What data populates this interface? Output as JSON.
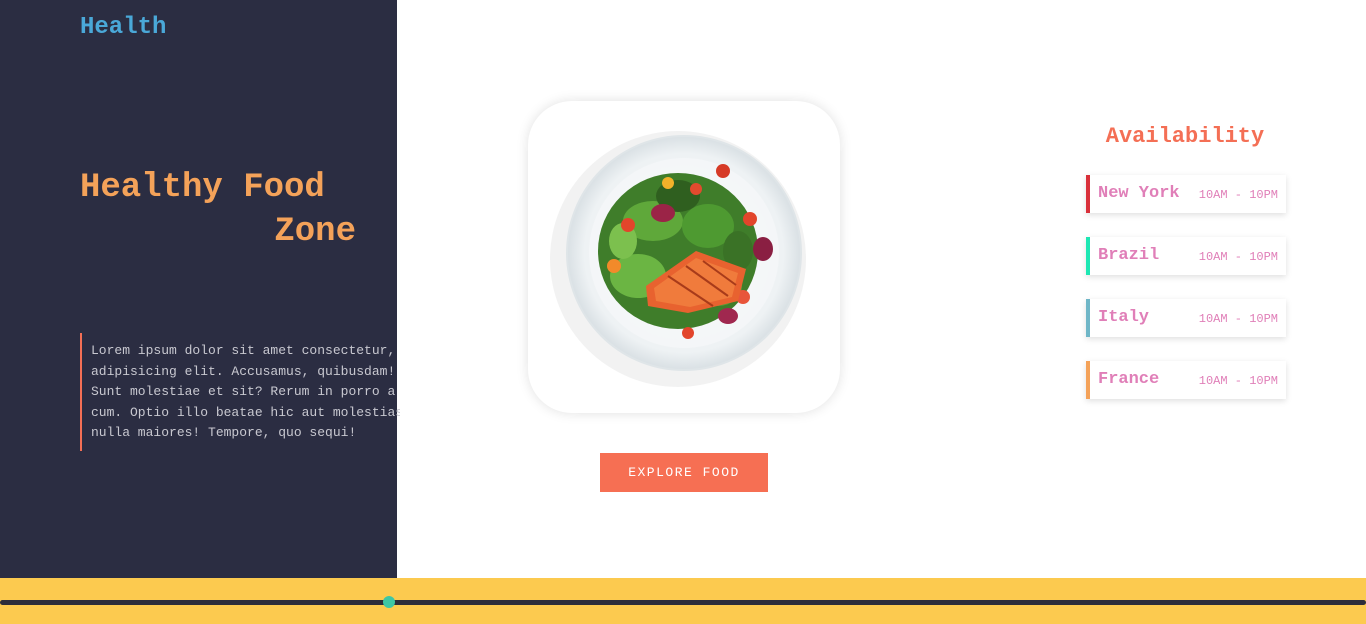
{
  "brand": "Health",
  "hero": {
    "title_line1": "Healthy Food",
    "title_line2": "Zone",
    "description_lines": [
      "Lorem ipsum dolor sit amet consectetur,",
      "adipisicing elit. Accusamus, quibusdam!",
      "Sunt molestiae et sit? Rerum in porro a",
      "cum. Optio illo beatae hic aut molestias",
      "nulla maiores! Tempore, quo sequi!"
    ]
  },
  "explore_button": "EXPLORE FOOD",
  "availability": {
    "title": "Availability",
    "items": [
      {
        "city": "New York",
        "hours": "10AM - 10PM",
        "accent": "#d9303a"
      },
      {
        "city": "Brazil",
        "hours": "10AM - 10PM",
        "accent": "#1de7b3"
      },
      {
        "city": "Italy",
        "hours": "10AM - 10PM",
        "accent": "#6fb6c7"
      },
      {
        "city": "France",
        "hours": "10AM - 10PM",
        "accent": "#f4a259"
      }
    ]
  },
  "slider": {
    "value_fraction": 0.285
  },
  "colors": {
    "sidebar": "#2b2d42",
    "brand": "#4aa8d8",
    "headline": "#f4a259",
    "accent": "#f46f55",
    "footer": "#fcca4f",
    "slider_thumb": "#3fc7a4"
  },
  "icons": {
    "food_image": "salmon-salad-plate-image"
  }
}
